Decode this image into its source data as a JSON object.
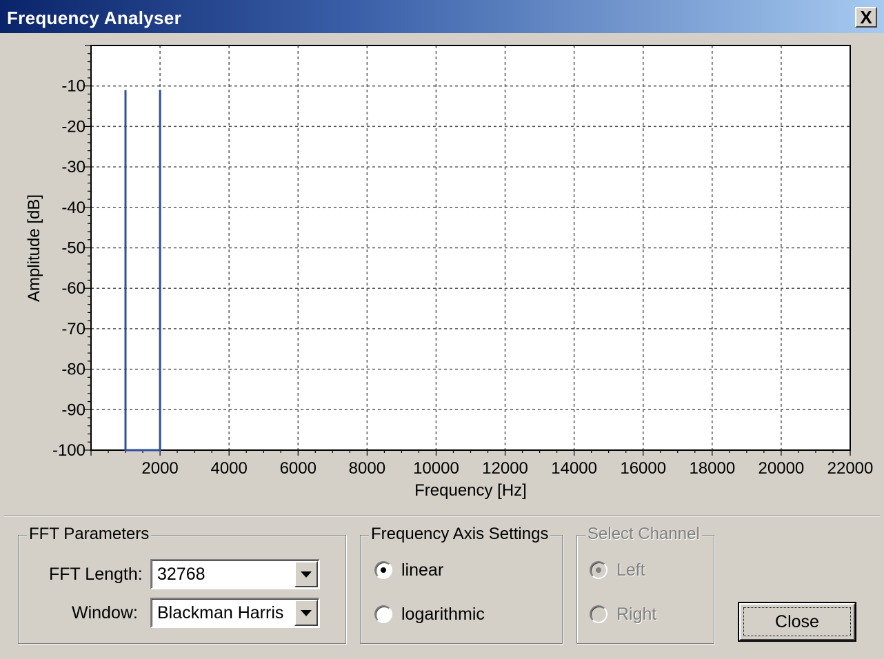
{
  "window": {
    "title": "Frequency Analyser",
    "close_glyph": "X"
  },
  "chart_data": {
    "type": "line",
    "xlabel": "Frequency [Hz]",
    "ylabel": "Amplitude [dB]",
    "xlim": [
      0,
      22000
    ],
    "ylim": [
      -100,
      0
    ],
    "x_ticks": [
      2000,
      4000,
      6000,
      8000,
      10000,
      12000,
      14000,
      16000,
      18000,
      20000,
      22000
    ],
    "x_tick_labels": [
      "2000",
      "4000",
      "6000",
      "8000",
      "10000",
      "12000",
      "14000",
      "16000",
      "18000",
      "20000",
      "22000"
    ],
    "y_ticks": [
      -10,
      -20,
      -30,
      -40,
      -50,
      -60,
      -70,
      -80,
      -90,
      -100
    ],
    "y_tick_labels": [
      "-10",
      "-20",
      "-30",
      "-40",
      "-50",
      "-60",
      "-70",
      "-80",
      "-90",
      "-100"
    ],
    "grid": true,
    "series": [
      {
        "color": "#2f4f9f",
        "points": [
          [
            1000,
            -100
          ],
          [
            1000,
            -11
          ],
          [
            1000,
            -100
          ],
          [
            2000,
            -100
          ],
          [
            2000,
            -11
          ],
          [
            2000,
            -100
          ]
        ]
      }
    ]
  },
  "fft": {
    "group_title": "FFT Parameters",
    "length_label": "FFT Length:",
    "length_value": "32768",
    "window_label": "Window:",
    "window_value": "Blackman Harris"
  },
  "freq_axis": {
    "group_title": "Frequency Axis Settings",
    "options": [
      {
        "label": "linear",
        "checked": true
      },
      {
        "label": "logarithmic",
        "checked": false
      }
    ]
  },
  "channel": {
    "group_title": "Select Channel",
    "options": [
      {
        "label": "Left",
        "checked": true,
        "enabled": false
      },
      {
        "label": "Right",
        "checked": false,
        "enabled": false
      }
    ]
  },
  "close_button": "Close"
}
